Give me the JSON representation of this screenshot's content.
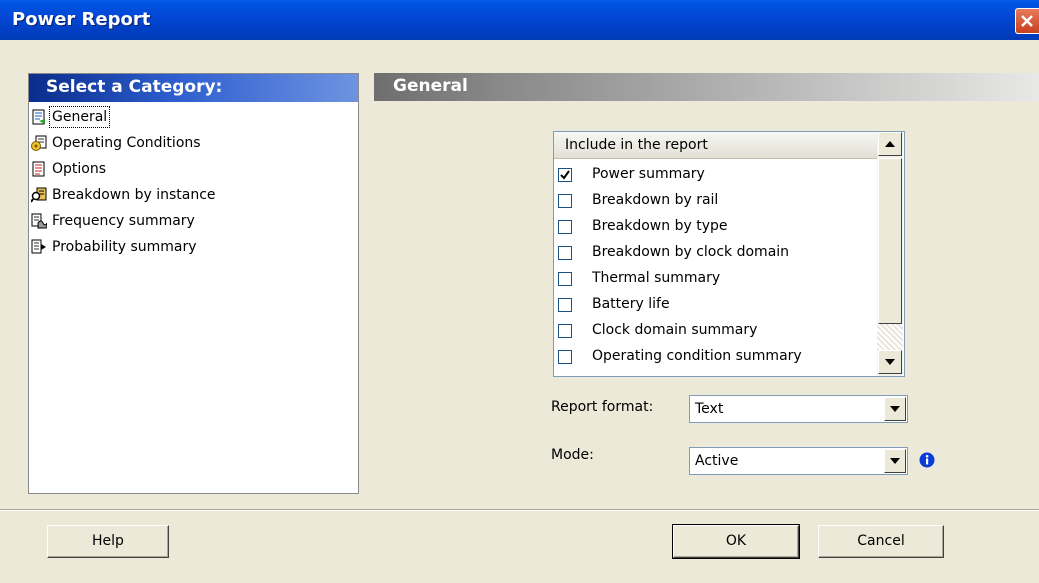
{
  "window": {
    "title": "Power Report"
  },
  "categories": {
    "header": "Select a Category:",
    "items": [
      {
        "label": "General",
        "icon": "report-page-icon",
        "selected": true
      },
      {
        "label": "Operating Conditions",
        "icon": "conditions-icon"
      },
      {
        "label": "Options",
        "icon": "options-page-icon"
      },
      {
        "label": "Breakdown by instance",
        "icon": "instance-search-icon"
      },
      {
        "label": "Frequency summary",
        "icon": "frequency-icon"
      },
      {
        "label": "Probability summary",
        "icon": "probability-icon"
      }
    ]
  },
  "general": {
    "header": "General",
    "include": {
      "title": "Include in the report",
      "items": [
        {
          "label": "Power summary",
          "checked": true
        },
        {
          "label": "Breakdown by rail",
          "checked": false
        },
        {
          "label": "Breakdown by type",
          "checked": false
        },
        {
          "label": "Breakdown by clock domain",
          "checked": false
        },
        {
          "label": "Thermal summary",
          "checked": false
        },
        {
          "label": "Battery life",
          "checked": false
        },
        {
          "label": "Clock domain summary",
          "checked": false
        },
        {
          "label": "Operating condition summary",
          "checked": false
        }
      ]
    },
    "report_format": {
      "label": "Report format:",
      "value": "Text"
    },
    "mode": {
      "label": "Mode:",
      "value": "Active"
    }
  },
  "buttons": {
    "help": "Help",
    "ok": "OK",
    "cancel": "Cancel"
  },
  "colors": {
    "title_bar": "#0054e3",
    "category_header": "#2f5fcf",
    "dialog_bg": "#ece9d8",
    "close_button": "#d2512b",
    "info_icon": "#0a3bd6"
  }
}
